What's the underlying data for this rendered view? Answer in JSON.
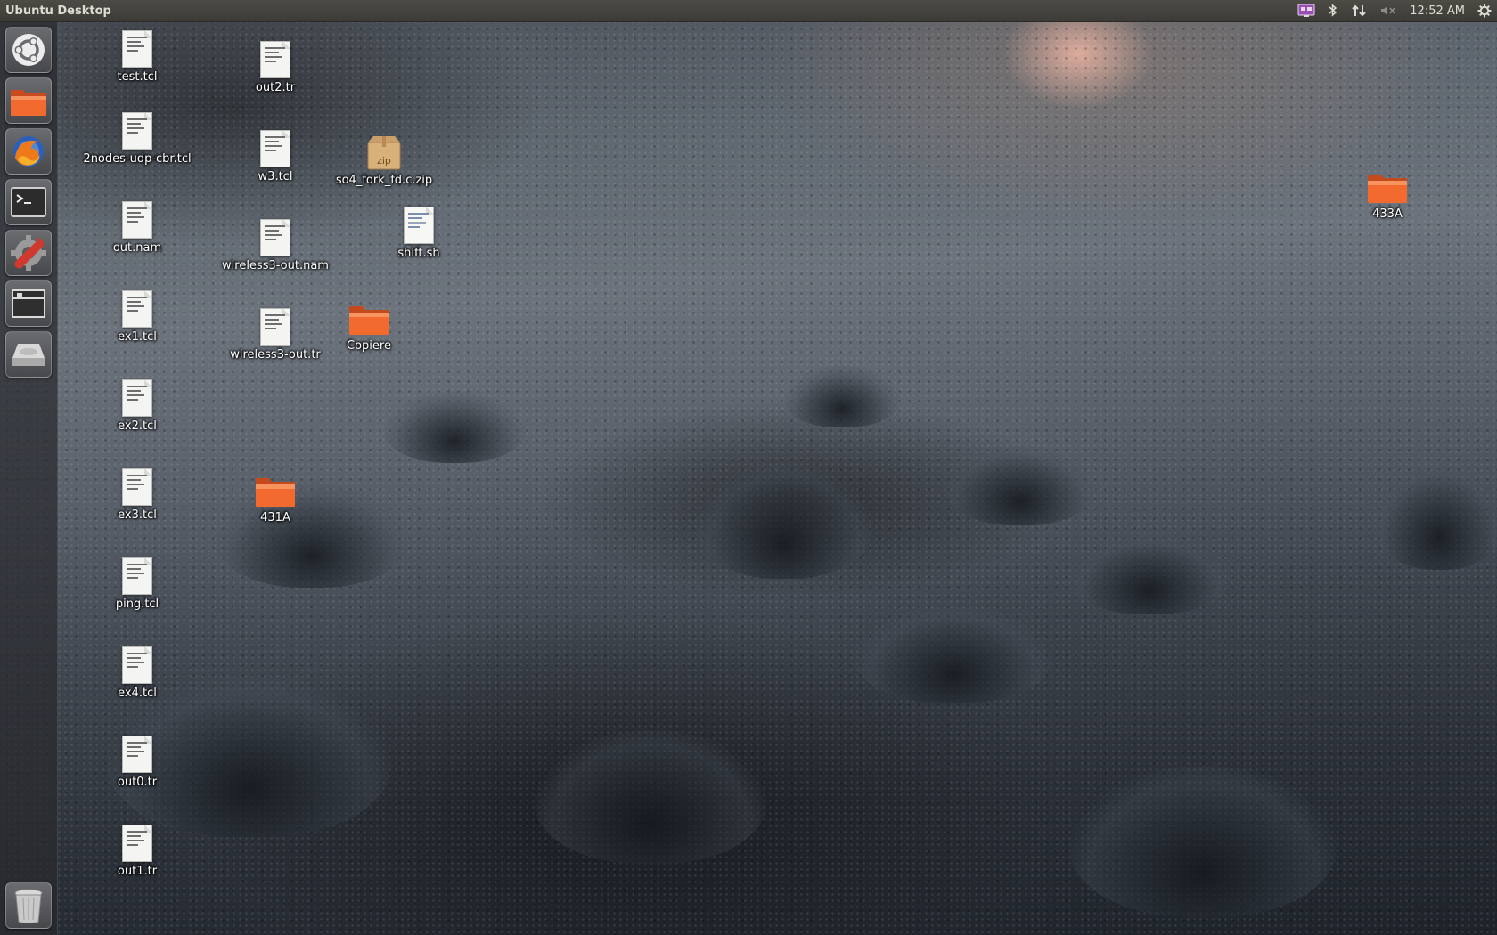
{
  "panel": {
    "title": "Ubuntu Desktop",
    "clock": "12:52 AM",
    "indicators": [
      "workspace-indicator-icon",
      "bluetooth-icon",
      "network-icon",
      "volume-muted-icon",
      "session-gear-icon"
    ]
  },
  "launcher": {
    "items": [
      {
        "name": "dash-home",
        "icon": "ubuntu-logo-icon"
      },
      {
        "name": "files",
        "icon": "folder-icon"
      },
      {
        "name": "firefox",
        "icon": "firefox-icon"
      },
      {
        "name": "terminal",
        "icon": "terminal-icon"
      },
      {
        "name": "system-settings",
        "icon": "settings-wrench-icon"
      },
      {
        "name": "workspace-switcher",
        "icon": "workspace-icon"
      },
      {
        "name": "disk-drive",
        "icon": "drive-icon"
      },
      {
        "name": "trash",
        "icon": "trash-icon"
      }
    ]
  },
  "desktop": {
    "icons": [
      {
        "label": "test.tcl",
        "type": "text"
      },
      {
        "label": "2nodes-udp-cbr.tcl",
        "type": "text"
      },
      {
        "label": "out.nam",
        "type": "text"
      },
      {
        "label": "ex1.tcl",
        "type": "text"
      },
      {
        "label": "ex2.tcl",
        "type": "text"
      },
      {
        "label": "ex3.tcl",
        "type": "text"
      },
      {
        "label": "ping.tcl",
        "type": "text"
      },
      {
        "label": "ex4.tcl",
        "type": "text"
      },
      {
        "label": "out0.tr",
        "type": "text"
      },
      {
        "label": "out1.tr",
        "type": "text"
      },
      {
        "label": "out2.tr",
        "type": "text"
      },
      {
        "label": "w3.tcl",
        "type": "text"
      },
      {
        "label": "wireless3-out.nam",
        "type": "text"
      },
      {
        "label": "wireless3-out.tr",
        "type": "text"
      },
      {
        "label": "431A",
        "type": "folder"
      },
      {
        "label": "so4_fork_fd.c.zip",
        "type": "zip",
        "badge": "zip"
      },
      {
        "label": "shift.sh",
        "type": "script"
      },
      {
        "label": "Copiere",
        "type": "folder"
      },
      {
        "label": "433A",
        "type": "folder"
      }
    ]
  },
  "colors": {
    "panel_bg": "#3c3b37",
    "panel_text": "#dfdbd2",
    "folder_orange": "#f26a2e",
    "launcher_bg": "#2a2c2f"
  }
}
